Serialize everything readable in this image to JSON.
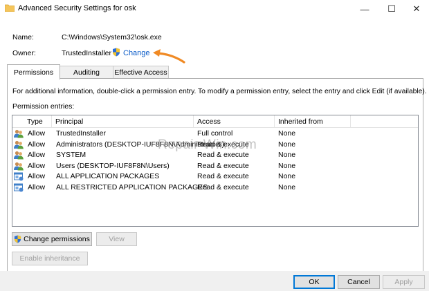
{
  "window": {
    "title": "Advanced Security Settings for osk",
    "minimize_glyph": "—",
    "maximize_glyph": "☐",
    "close_glyph": "✕"
  },
  "object": {
    "name_label": "Name:",
    "name_value": "C:\\Windows\\System32\\osk.exe",
    "owner_label": "Owner:",
    "owner_value": "TrustedInstaller",
    "change_link": "Change"
  },
  "tabs": [
    {
      "label": "Permissions",
      "active": true
    },
    {
      "label": "Auditing",
      "active": false
    },
    {
      "label": "Effective Access",
      "active": false
    }
  ],
  "permissions": {
    "info_text": "For additional information, double-click a permission entry. To modify a permission entry, select the entry and click Edit (if available).",
    "entries_label": "Permission entries:",
    "columns": [
      "Type",
      "Principal",
      "Access",
      "Inherited from"
    ],
    "rows": [
      {
        "type": "Allow",
        "principal": "TrustedInstaller",
        "access": "Full control",
        "inherited": "None",
        "icon": "users-icon"
      },
      {
        "type": "Allow",
        "principal": "Administrators (DESKTOP-IUF8F8N\\Administrators)",
        "access": "Read & execute",
        "inherited": "None",
        "icon": "users-icon"
      },
      {
        "type": "Allow",
        "principal": "SYSTEM",
        "access": "Read & execute",
        "inherited": "None",
        "icon": "users-icon"
      },
      {
        "type": "Allow",
        "principal": "Users (DESKTOP-IUF8F8N\\Users)",
        "access": "Read & execute",
        "inherited": "None",
        "icon": "users-icon"
      },
      {
        "type": "Allow",
        "principal": "ALL APPLICATION PACKAGES",
        "access": "Read & execute",
        "inherited": "None",
        "icon": "package-icon"
      },
      {
        "type": "Allow",
        "principal": "ALL RESTRICTED APPLICATION PACKAGES",
        "access": "Read & execute",
        "inherited": "None",
        "icon": "package-icon"
      }
    ],
    "change_permissions_button": "Change permissions",
    "view_button": "View",
    "enable_inheritance_button": "Enable inheritance"
  },
  "dialog_buttons": {
    "ok": "OK",
    "cancel": "Cancel",
    "apply": "Apply"
  },
  "watermark": "Repair-Win.com",
  "colors": {
    "link": "#0a5bc8",
    "annotation_arrow": "#f08a24",
    "default_button_border": "#0078d7"
  }
}
